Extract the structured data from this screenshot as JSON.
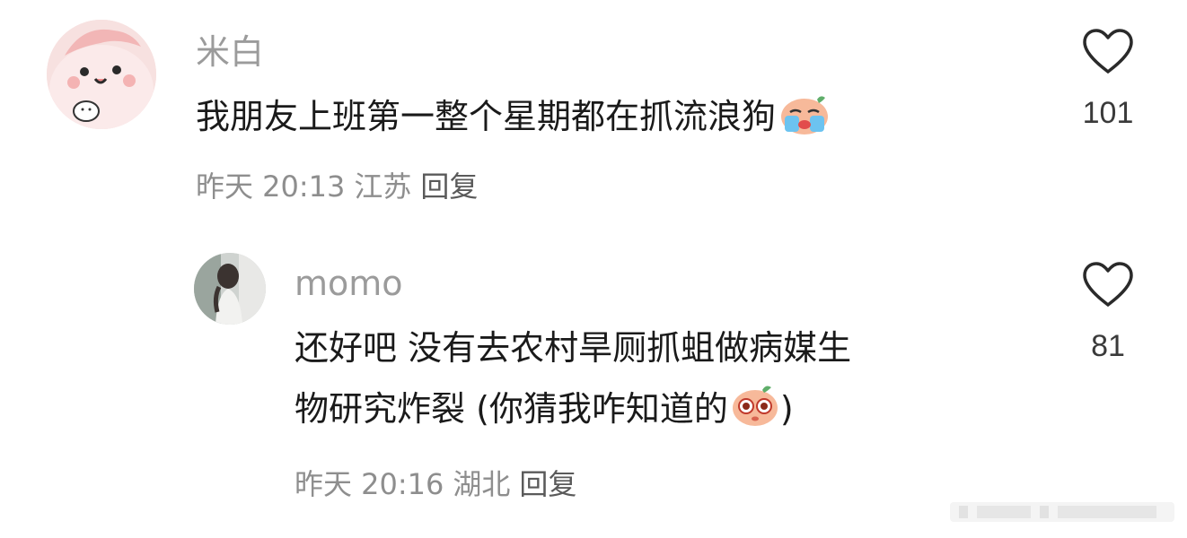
{
  "comments": [
    {
      "username": "米白",
      "text_lines": [
        "我朋友上班第一整个星期都在抓流浪狗"
      ],
      "emoji": "crying-face-emoji",
      "time": "昨天 20:13",
      "location": "江苏",
      "reply_label": "回复",
      "likes": "101",
      "avatar": "pink-cartoon-avatar"
    },
    {
      "username": "momo",
      "text_lines": [
        "还好吧 没有去农村旱厕抓蛆做病媒生",
        "物研究炸裂 (你猜我咋知道的",
        ")"
      ],
      "emoji": "wide-eyes-emoji",
      "time": "昨天 20:16",
      "location": "湖北",
      "reply_label": "回复",
      "likes": "81",
      "avatar": "photo-avatar"
    }
  ],
  "colors": {
    "username": "#9b9b9b",
    "text": "#1a1a1a",
    "meta": "#8e8e8e",
    "avatar_pink": "#f6dcdc"
  },
  "icons": [
    "heart-outline-icon"
  ]
}
